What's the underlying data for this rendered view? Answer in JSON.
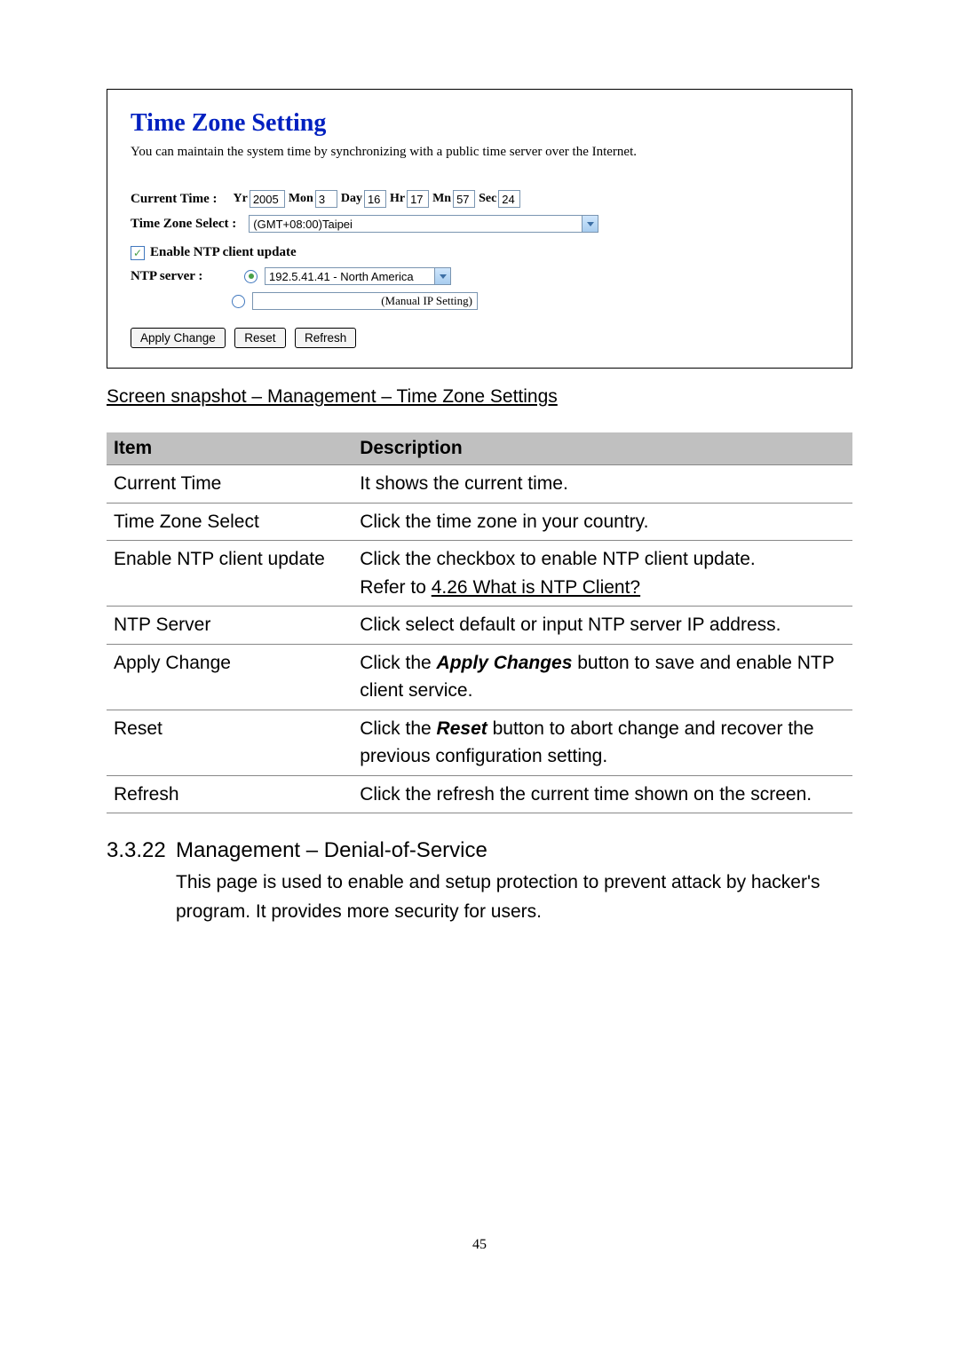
{
  "panel": {
    "title": "Time Zone Setting",
    "subtitle": "You can maintain the system time by synchronizing with a public time server over the Internet.",
    "current_time_label": "Current Time :",
    "yr_label": "Yr",
    "yr_value": "2005",
    "mon_label": "Mon",
    "mon_value": "3",
    "day_label": "Day",
    "day_value": "16",
    "hr_label": "Hr",
    "hr_value": "17",
    "mn_label": "Mn",
    "mn_value": "57",
    "sec_label": "Sec",
    "sec_value": "24",
    "timezone_label": "Time Zone Select :",
    "timezone_value": "(GMT+08:00)Taipei",
    "enable_ntp_label": "Enable NTP client update",
    "ntp_server_label": "NTP server :",
    "ntp_server_value": "192.5.41.41 - North America",
    "manual_ip_value": "(Manual IP Setting)",
    "apply_btn": "Apply Change",
    "reset_btn": "Reset",
    "refresh_btn": "Refresh"
  },
  "caption": "Screen snapshot – Management – Time Zone Settings",
  "table": {
    "head_item": "Item",
    "head_desc": "Description",
    "rows": [
      {
        "item": "Current Time",
        "desc_plain": "It shows the current time."
      },
      {
        "item": "Time Zone Select",
        "desc_plain": "Click the time zone in your country."
      },
      {
        "item": "Enable NTP client update",
        "desc_line1": "Click the checkbox to enable NTP client update.",
        "desc_line2_prefix": "Refer to ",
        "desc_line2_link": "4.26 What is NTP Client?"
      },
      {
        "item": "NTP Server",
        "desc_plain": "Click select default or input NTP server IP address."
      },
      {
        "item": "Apply Change",
        "desc_prefix": "Click the ",
        "desc_bold": "Apply Changes",
        "desc_suffix": " button to save and enable NTP client service."
      },
      {
        "item": "Reset",
        "desc_prefix": "Click the ",
        "desc_bold": "Reset",
        "desc_suffix": " button to abort change and recover the previous configuration setting."
      },
      {
        "item": "Refresh",
        "desc_plain": "Click the refresh the current time shown on the screen."
      }
    ]
  },
  "section": {
    "number": "3.3.22",
    "title": "Management – Denial-of-Service",
    "body": "This page is used to enable and setup protection to prevent attack by hacker's program. It provides more security for users."
  },
  "page_number": "45"
}
